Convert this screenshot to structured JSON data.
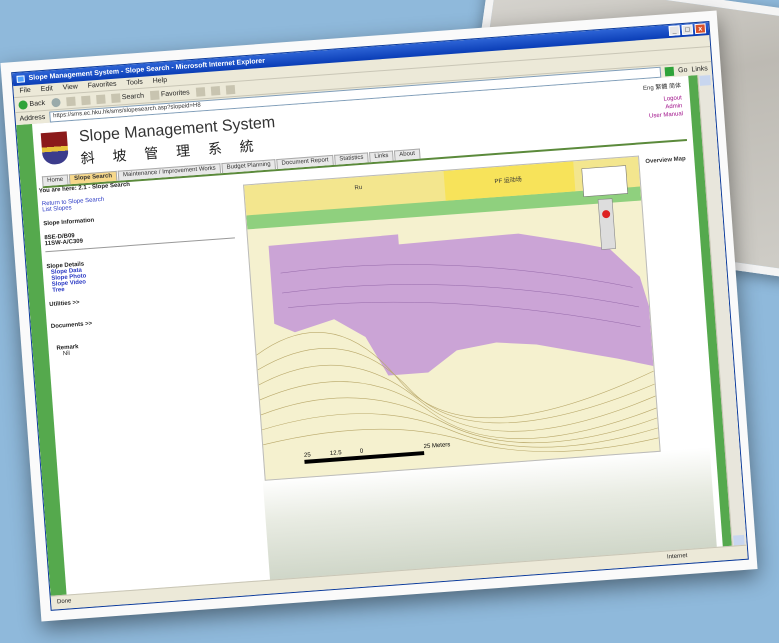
{
  "window": {
    "title": "Slope Management System - Slope Search - Microsoft Internet Explorer",
    "controls": [
      "_",
      "□",
      "x"
    ]
  },
  "menu": [
    "File",
    "Edit",
    "View",
    "Favorites",
    "Tools",
    "Help"
  ],
  "toolbar": {
    "back": "Back",
    "search": "Search",
    "favorites": "Favorites"
  },
  "address": {
    "label": "Address",
    "url": "https://sms.ec.hku.hk/sms/slopesearch.asp?slopeid=H8",
    "go": "Go",
    "links": "Links"
  },
  "header": {
    "title": "Slope Management System",
    "title_cn": "斜 坡 管 理 系 統",
    "lang": "Eng  繁體  简体",
    "links": [
      "Logout",
      "Admin",
      "User Manual"
    ]
  },
  "tabs": [
    "Home",
    "Slope Search",
    "Maintenance / Improvement Works",
    "Budget Planning",
    "Document Report",
    "Statistics",
    "Links",
    "About"
  ],
  "breadcrumb": "You are here: 2.1 - Slope Search",
  "sidebar": {
    "return_link": "Return to Slope Search",
    "list_link": "List Slopes",
    "info_heading": "Slope Information",
    "slope_no": "8SE-D/B09",
    "slope_ref": "11SW-A/C309",
    "details_heading": "Slope Details",
    "detail_links": [
      "Slope Data",
      "Slope Photo",
      "Slope Video",
      "Tree"
    ],
    "utilities": "Utilities >>",
    "documents": "Documents >>",
    "remark_heading": "Remark",
    "remark_value": "Nil"
  },
  "map": {
    "label_top": "Ru",
    "label_building": "PF 运动场",
    "scale_labels": [
      "25",
      "12.5",
      "0",
      "25 Meters"
    ]
  },
  "overview": {
    "label": "Overview Map"
  },
  "status": {
    "left": "Done",
    "zone": "Internet"
  }
}
